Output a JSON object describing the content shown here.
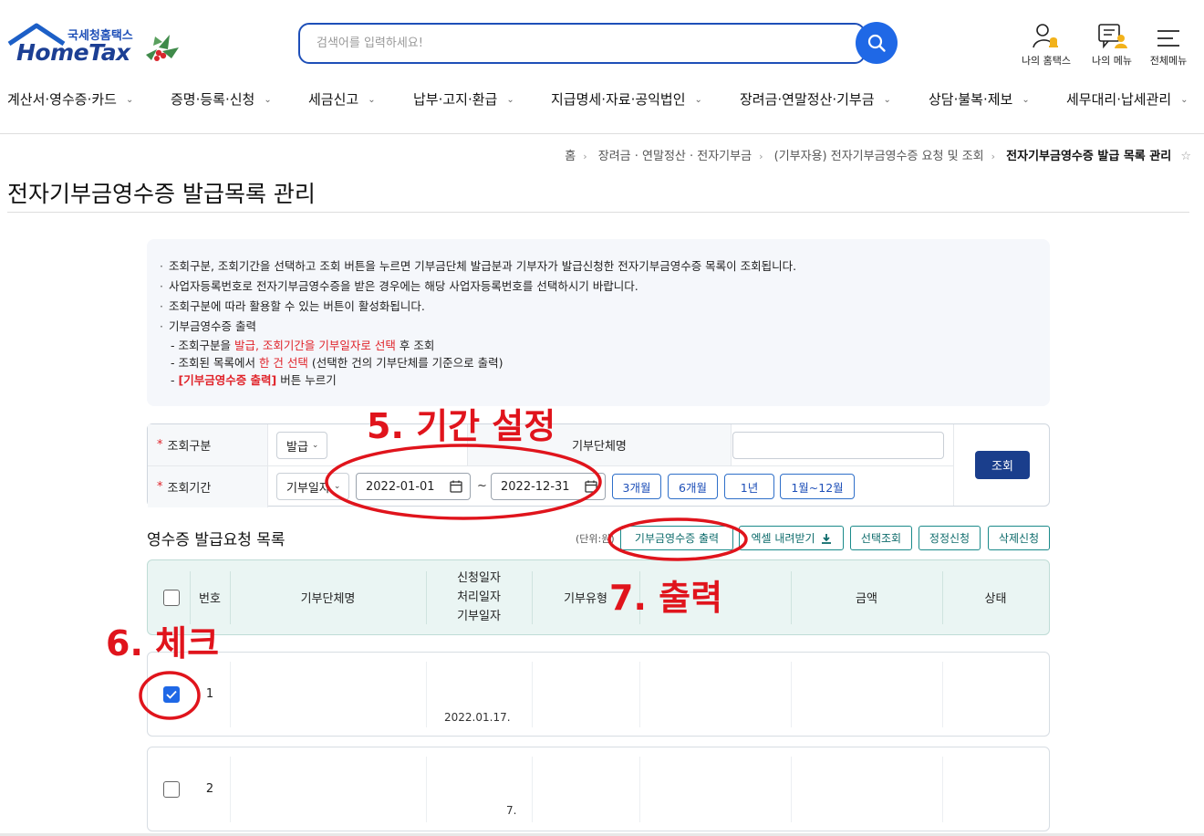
{
  "header": {
    "logo_sub": "국세청홈택스",
    "logo_main": "HomeTax",
    "search_placeholder": "검색어를 입력하세요!",
    "util": [
      "나의 홈택스",
      "나의 메뉴",
      "전체메뉴"
    ]
  },
  "gnb": [
    "계산서·영수증·카드",
    "증명·등록·신청",
    "세금신고",
    "납부·고지·환급",
    "지급명세·자료·공익법인",
    "장려금·연말정산·기부금",
    "상담·불복·제보",
    "세무대리·납세관리"
  ],
  "breadcrumb": {
    "home": "홈",
    "level1": "장려금 · 연말정산 · 전자기부금",
    "level2": "(기부자용) 전자기부금영수증 요청 및 조회",
    "current": "전자기부금영수증 발급 목록 관리"
  },
  "page_title": "전자기부금영수증 발급목록 관리",
  "guide": {
    "line1": "조회구분, 조회기간을 선택하고 조회 버튼을 누르면 기부금단체 발급분과 기부자가 발급신청한 전자기부금영수증 목록이 조회됩니다.",
    "line2": "사업자등록번호로 전자기부금영수증을 받은 경우에는 해당 사업자등록번호를 선택하시기 바랍니다.",
    "line3": "조회구분에 따라 활용할 수 있는 버튼이 활성화됩니다.",
    "line4": "기부금영수증 출력",
    "sub1_a": "- 조회구분을 ",
    "sub1_b": "발급, 조회기간을 기부일자로 선택",
    "sub1_c": " 후 조회",
    "sub2_a": "- 조회된 목록에서 ",
    "sub2_b": "한 건 선택",
    "sub2_c": " (선택한 건의 기부단체를 기준으로 출력)",
    "sub3_a": "- ",
    "sub3_b": "[기부금영수증 출력]",
    "sub3_c": " 버튼 누르기"
  },
  "form": {
    "label_type": "조회구분",
    "type_value": "발급",
    "label_org": "기부단체명",
    "label_period": "조회기간",
    "period_type": "기부일자",
    "date_from": "2022-01-01",
    "tilde": "~",
    "date_to": "2022-12-31",
    "period_buttons": [
      "3개월",
      "6개월",
      "1년",
      "1월~12월"
    ],
    "query_button": "조회"
  },
  "list": {
    "title": "영수증 발급요청 목록",
    "unit": "(단위:원)",
    "actions": [
      "기부금영수증 출력",
      "엑셀 내려받기",
      "선택조회",
      "정정신청",
      "삭제신청"
    ],
    "headers": {
      "no": "번호",
      "org": "기부단체명",
      "date1": "신청일자",
      "date2": "처리일자",
      "date3": "기부일자",
      "type": "기부유형",
      "amount": "금액",
      "status": "상태"
    },
    "rows": [
      {
        "no": "1",
        "date_bottom": "2022.01.17.",
        "checked": true
      },
      {
        "no": "2",
        "date_bottom": "7.",
        "checked": false
      }
    ]
  },
  "annotations": {
    "step5": "5. 기간 설정",
    "step6": "6. 체크",
    "step7": "7. 출력"
  },
  "colors": {
    "brand": "#1e4fb8",
    "search_button": "#1f68e6",
    "query_button": "#1a3e8c",
    "annotation": "#e0141c",
    "table_header": "#eaf5f3"
  }
}
